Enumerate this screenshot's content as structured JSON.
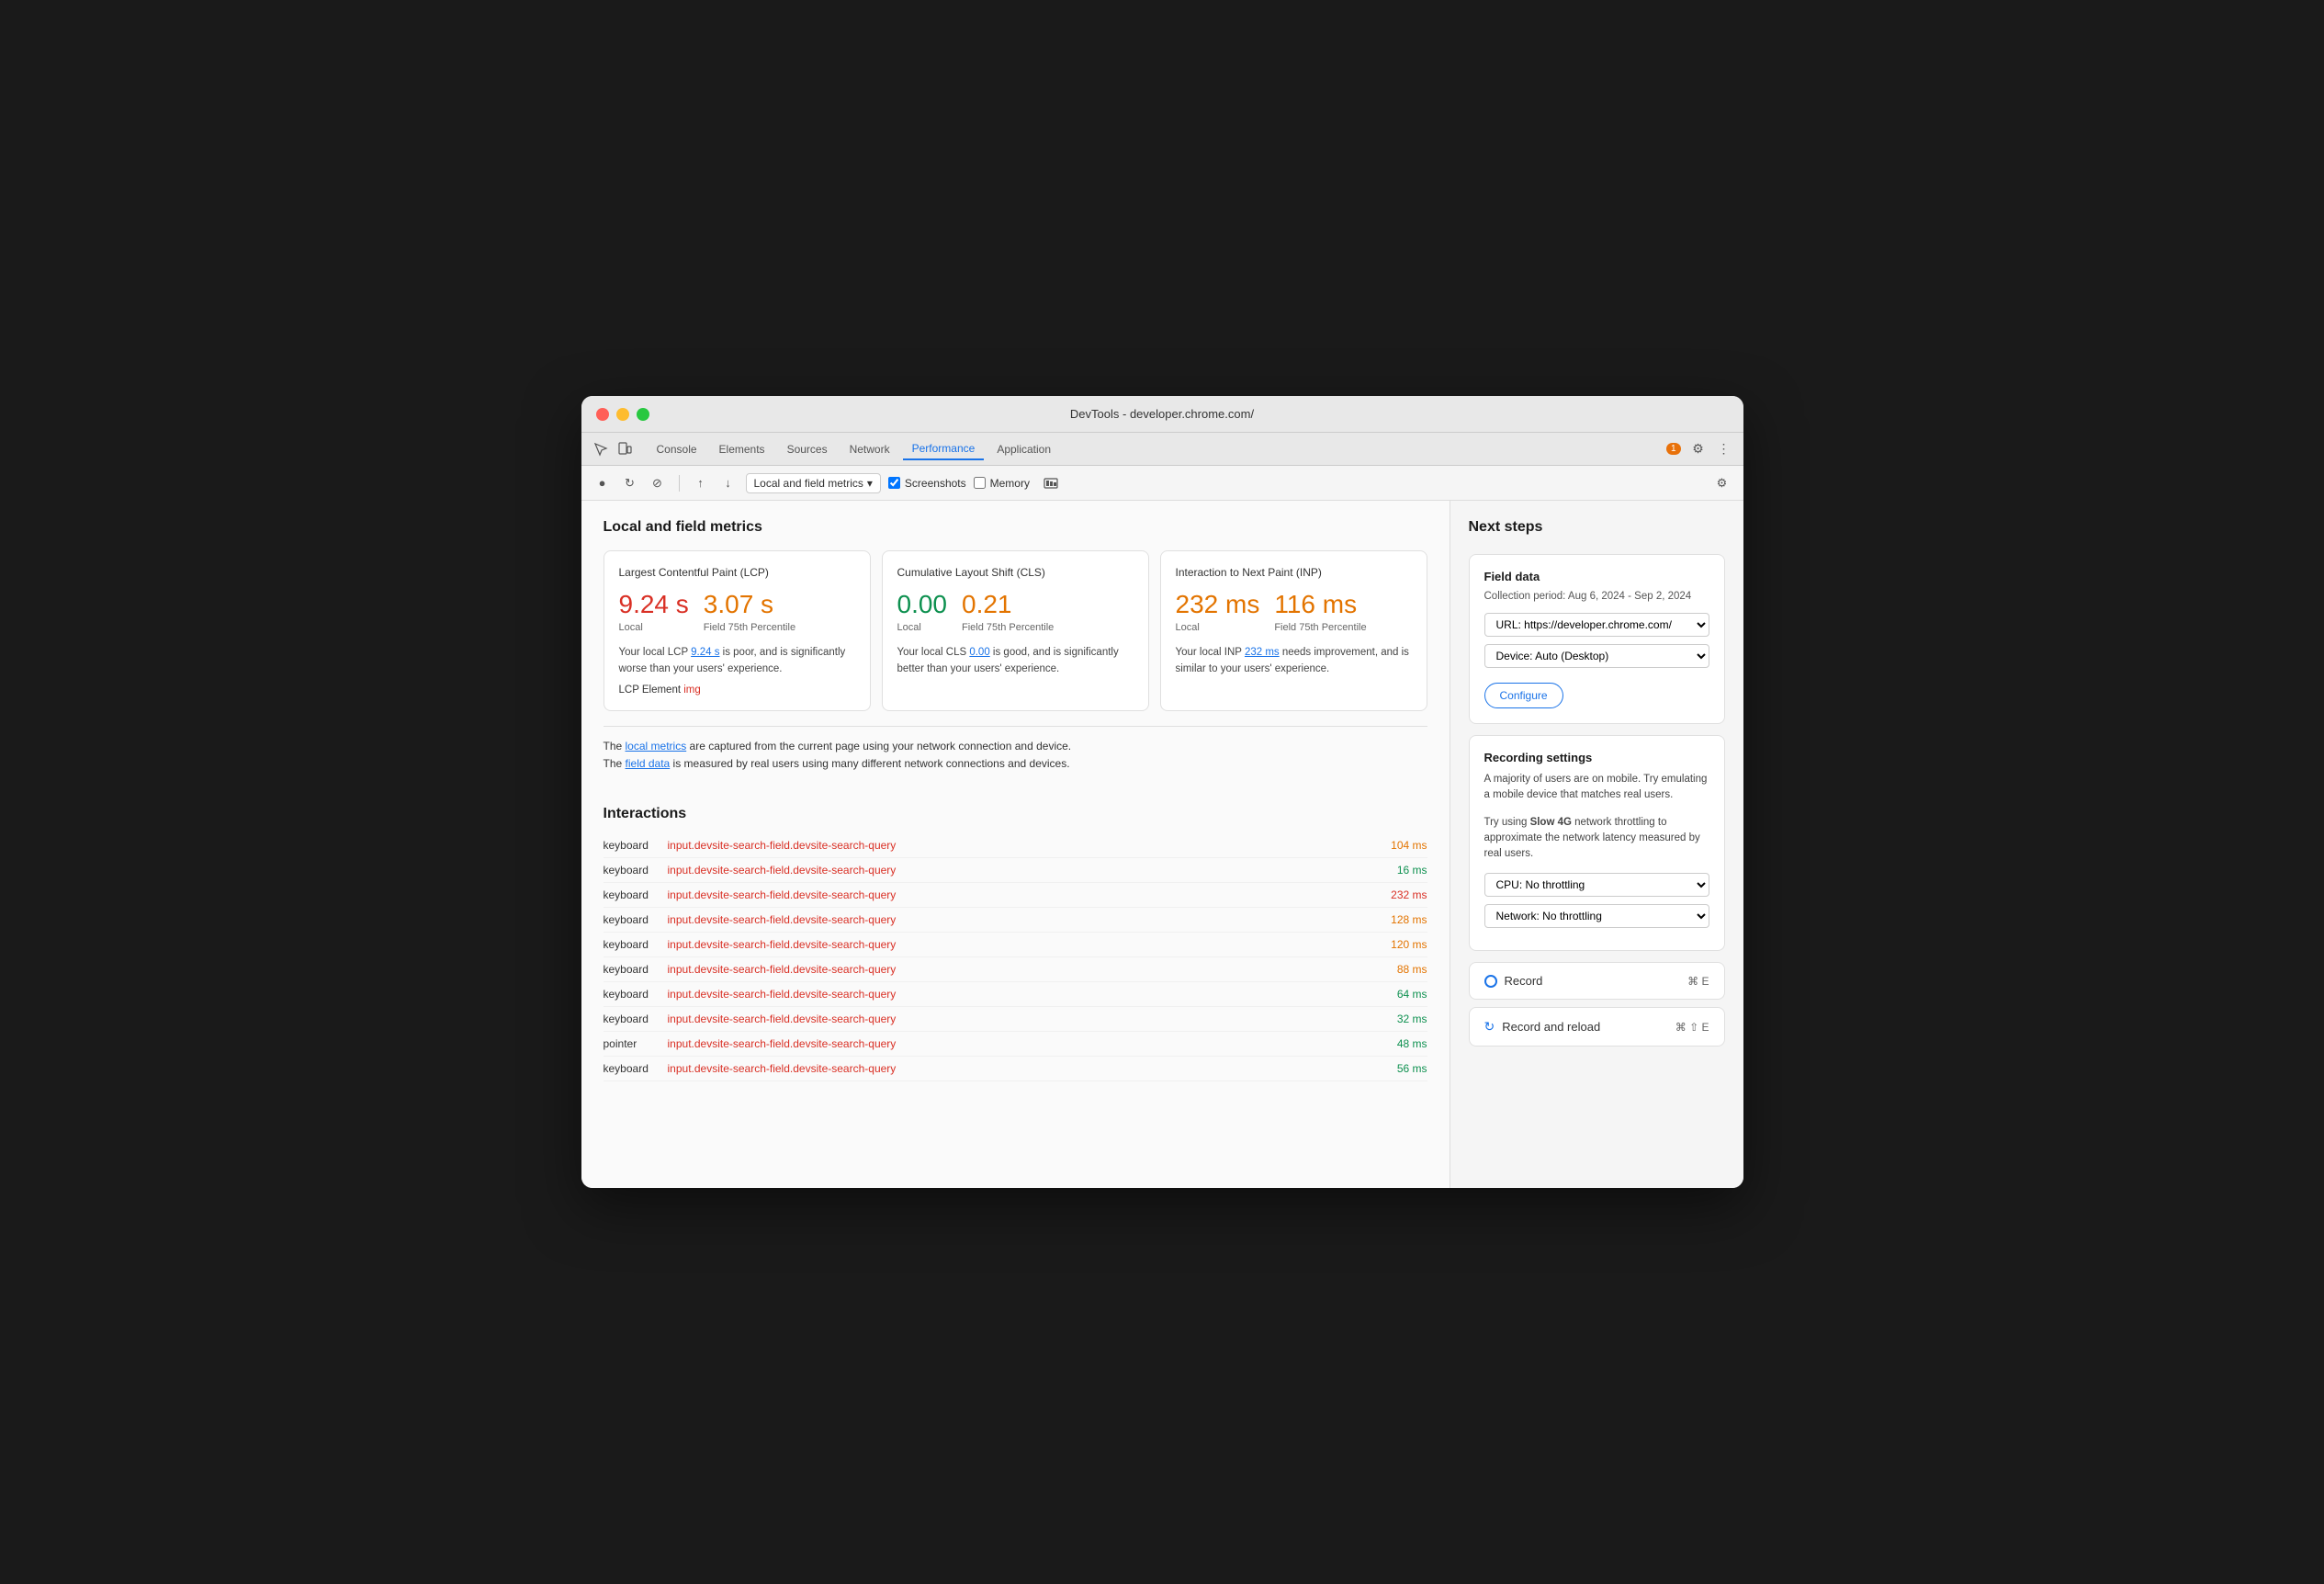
{
  "window": {
    "title": "DevTools - developer.chrome.com/"
  },
  "tabs": {
    "items": [
      {
        "label": "Console",
        "active": false
      },
      {
        "label": "Elements",
        "active": false
      },
      {
        "label": "Sources",
        "active": false
      },
      {
        "label": "Network",
        "active": false
      },
      {
        "label": "Performance",
        "active": true
      },
      {
        "label": "Application",
        "active": false
      }
    ],
    "badge": "1"
  },
  "toolbar": {
    "dropdown_label": "Local and field metrics",
    "screenshots_label": "Screenshots",
    "memory_label": "Memory"
  },
  "main": {
    "section_title": "Local and field metrics",
    "metrics": [
      {
        "title": "Largest Contentful Paint (LCP)",
        "local_value": "9.24 s",
        "field_value": "3.07 s",
        "local_color": "red",
        "field_color": "orange",
        "field_label": "Field 75th Percentile",
        "description": "Your local LCP 9.24 s is poor, and is significantly worse than your users' experience.",
        "element_label": "LCP Element",
        "element_value": "img"
      },
      {
        "title": "Cumulative Layout Shift (CLS)",
        "local_value": "0.00",
        "field_value": "0.21",
        "local_color": "green",
        "field_color": "orange",
        "field_label": "Field 75th Percentile",
        "description": "Your local CLS 0.00 is good, and is significantly better than your users' experience.",
        "element_label": "",
        "element_value": ""
      },
      {
        "title": "Interaction to Next Paint (INP)",
        "local_value": "232 ms",
        "field_value": "116 ms",
        "local_color": "orange",
        "field_color": "orange",
        "field_label": "Field 75th Percentile",
        "description": "Your local INP 232 ms needs improvement, and is similar to your users' experience.",
        "element_label": "",
        "element_value": ""
      }
    ],
    "info_line1": "The local metrics are captured from the current page using your network connection and device.",
    "info_line2": "The field data is measured by real users using many different network connections and devices.",
    "interactions_title": "Interactions",
    "interactions": [
      {
        "type": "keyboard",
        "link": "input.devsite-search-field.devsite-search-query",
        "time": "104 ms",
        "time_color": "orange"
      },
      {
        "type": "keyboard",
        "link": "input.devsite-search-field.devsite-search-query",
        "time": "16 ms",
        "time_color": "green"
      },
      {
        "type": "keyboard",
        "link": "input.devsite-search-field.devsite-search-query",
        "time": "232 ms",
        "time_color": "red"
      },
      {
        "type": "keyboard",
        "link": "input.devsite-search-field.devsite-search-query",
        "time": "128 ms",
        "time_color": "orange"
      },
      {
        "type": "keyboard",
        "link": "input.devsite-search-field.devsite-search-query",
        "time": "120 ms",
        "time_color": "orange"
      },
      {
        "type": "keyboard",
        "link": "input.devsite-search-field.devsite-search-query",
        "time": "88 ms",
        "time_color": "orange"
      },
      {
        "type": "keyboard",
        "link": "input.devsite-search-field.devsite-search-query",
        "time": "64 ms",
        "time_color": "green"
      },
      {
        "type": "keyboard",
        "link": "input.devsite-search-field.devsite-search-query",
        "time": "32 ms",
        "time_color": "green"
      },
      {
        "type": "pointer",
        "link": "input.devsite-search-field.devsite-search-query",
        "time": "48 ms",
        "time_color": "green"
      },
      {
        "type": "keyboard",
        "link": "input.devsite-search-field.devsite-search-query",
        "time": "56 ms",
        "time_color": "green"
      }
    ]
  },
  "right_panel": {
    "title": "Next steps",
    "field_data": {
      "title": "Field data",
      "collection_period": "Collection period: Aug 6, 2024 - Sep 2, 2024",
      "url_option": "URL: https://developer.chrome.com/",
      "device_option": "Device: Auto (Desktop)",
      "configure_label": "Configure"
    },
    "recording_settings": {
      "title": "Recording settings",
      "desc1": "A majority of users are on mobile. Try emulating a mobile device that matches real users.",
      "desc2": "Try using",
      "desc2_bold": "Slow 4G",
      "desc2_rest": " network throttling to approximate the network latency measured by real users.",
      "cpu_option": "CPU: No throttling",
      "network_option": "Network: No throttling"
    },
    "record": {
      "label": "Record",
      "shortcut": "⌘ E"
    },
    "record_reload": {
      "label": "Record and reload",
      "shortcut": "⌘ ⇧ E"
    }
  }
}
